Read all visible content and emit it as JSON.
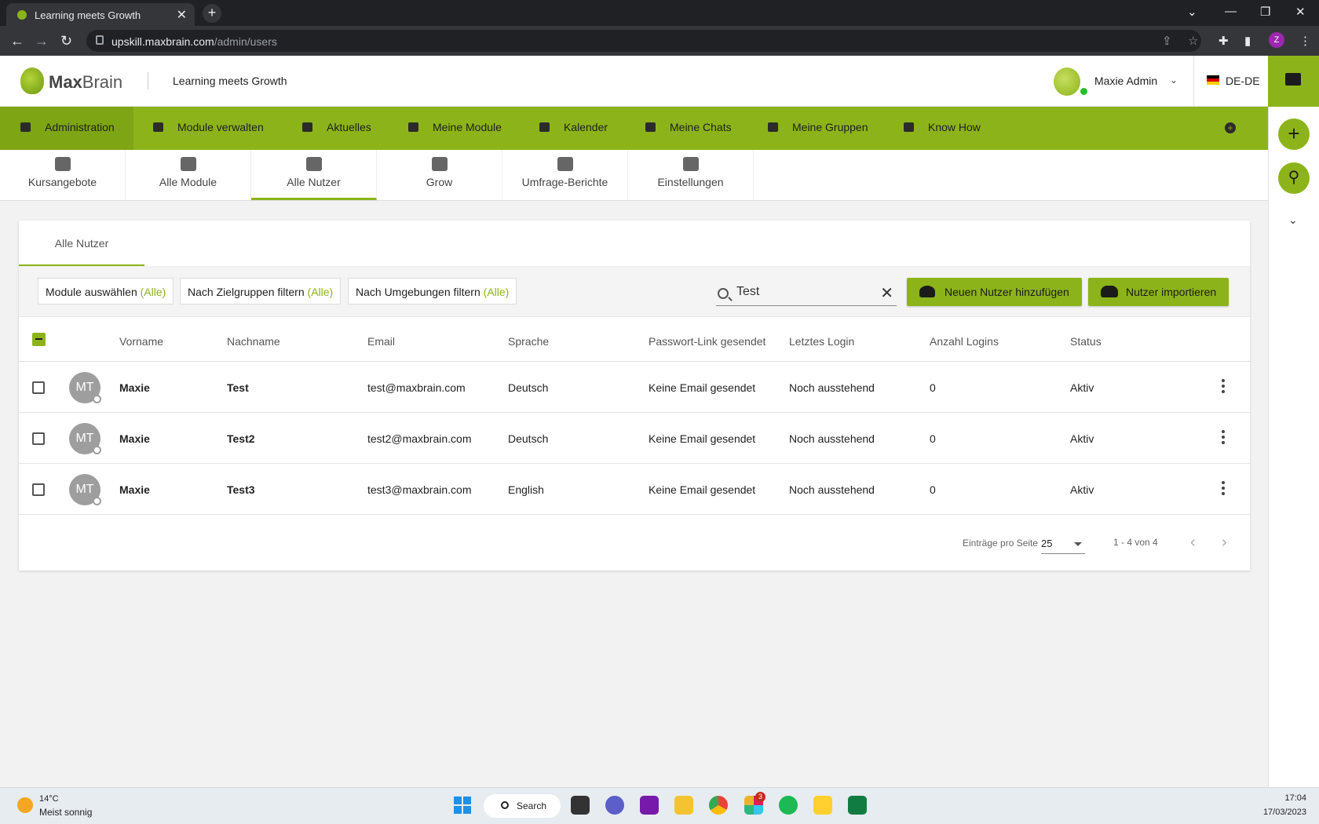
{
  "browser": {
    "tab_title": "Learning meets Growth",
    "tab_close": "✕",
    "new_tab": "+",
    "url_host": "upskill.maxbrain.com",
    "url_path": "/admin/users",
    "profile_initial": "Z"
  },
  "header": {
    "logo_bold": "Max",
    "logo_rest": "Brain",
    "tagline": "Learning meets Growth",
    "user_name": "Maxie Admin",
    "language": "DE-DE"
  },
  "nav": {
    "items": [
      {
        "label": "Administration",
        "icon": "admin-icon"
      },
      {
        "label": "Module verwalten",
        "icon": "module-manage-icon"
      },
      {
        "label": "Aktuelles",
        "icon": "news-icon"
      },
      {
        "label": "Meine Module",
        "icon": "graduation-cap-icon"
      },
      {
        "label": "Kalender",
        "icon": "calendar-icon"
      },
      {
        "label": "Meine Chats",
        "icon": "chat-icon"
      },
      {
        "label": "Meine Gruppen",
        "icon": "groups-icon"
      },
      {
        "label": "Know How",
        "icon": "book-icon"
      }
    ],
    "active_index": 0
  },
  "subtabs": [
    {
      "label": "Kursangebote",
      "icon": "course-offer-icon"
    },
    {
      "label": "Alle Module",
      "icon": "bank-icon"
    },
    {
      "label": "Alle Nutzer",
      "icon": "users-icon"
    },
    {
      "label": "Grow",
      "icon": "team-icon"
    },
    {
      "label": "Umfrage-Berichte",
      "icon": "report-icon"
    },
    {
      "label": "Einstellungen",
      "icon": "gears-icon"
    }
  ],
  "card": {
    "tab_label": "Alle Nutzer",
    "filters": [
      {
        "label": "Module auswählen",
        "value": "(Alle)"
      },
      {
        "label": "Nach Zielgruppen filtern",
        "value": "(Alle)"
      },
      {
        "label": "Nach Umgebungen filtern",
        "value": "(Alle)"
      }
    ],
    "search_value": "Test",
    "add_user_label": "Neuen Nutzer hinzufügen",
    "import_label": "Nutzer importieren"
  },
  "table": {
    "columns": [
      "Vorname",
      "Nachname",
      "Email",
      "Sprache",
      "Passwort-Link gesendet",
      "Letztes Login",
      "Anzahl Logins",
      "Status"
    ],
    "rows": [
      {
        "initials": "MT",
        "first": "Maxie",
        "last": "Test",
        "email": "test@maxbrain.com",
        "lang": "Deutsch",
        "pwlink": "Keine Email gesendet",
        "last_login": "Noch ausstehend",
        "logins": "0",
        "status": "Aktiv"
      },
      {
        "initials": "MT",
        "first": "Maxie",
        "last": "Test2",
        "email": "test2@maxbrain.com",
        "lang": "Deutsch",
        "pwlink": "Keine Email gesendet",
        "last_login": "Noch ausstehend",
        "logins": "0",
        "status": "Aktiv"
      },
      {
        "initials": "MT",
        "first": "Maxie",
        "last": "Test3",
        "email": "test3@maxbrain.com",
        "lang": "English",
        "pwlink": "Keine Email gesendet",
        "last_login": "Noch ausstehend",
        "logins": "0",
        "status": "Aktiv"
      }
    ]
  },
  "pagination": {
    "per_page_label": "Einträge pro Seite",
    "per_page_value": "25",
    "range": "1 - 4 von 4"
  },
  "taskbar": {
    "temp": "14°C",
    "weather": "Meist sonnig",
    "search_label": "Search",
    "badge": "3",
    "time": "17:04",
    "date": "17/03/2023"
  },
  "colors": {
    "brand_green": "#8cb41a",
    "nav_active": "#7ea514"
  }
}
